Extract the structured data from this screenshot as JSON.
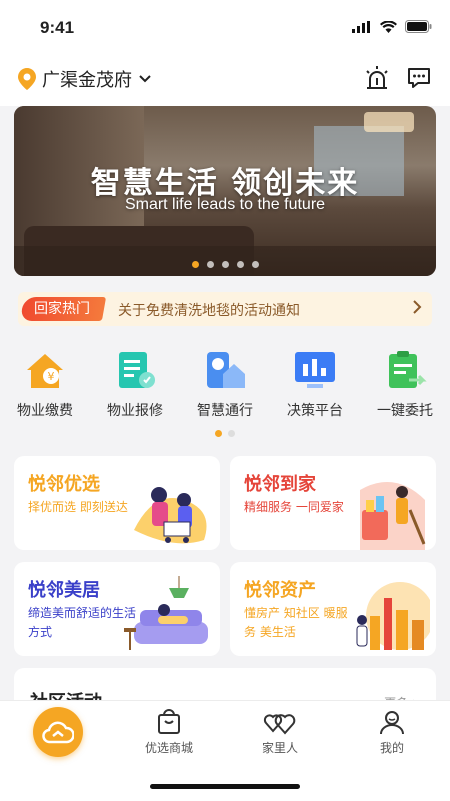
{
  "status": {
    "time": "9:41"
  },
  "header": {
    "location": "广渠金茂府"
  },
  "banner": {
    "title": "智慧生活 领创未来",
    "subtitle": "Smart life leads to the future",
    "dot_count": 5,
    "active_dot": 0
  },
  "notice": {
    "tag": "回家热门",
    "text": "关于免费清洗地毯的活动通知"
  },
  "services": [
    {
      "label": "物业缴费",
      "icon": "property-fee-icon",
      "color": "#f5a623"
    },
    {
      "label": "物业报修",
      "icon": "repair-icon",
      "color": "#26c6b0"
    },
    {
      "label": "智慧通行",
      "icon": "smart-access-icon",
      "color": "#4a8ef0"
    },
    {
      "label": "决策平台",
      "icon": "decision-platform-icon",
      "color": "#3b7cf5"
    },
    {
      "label": "一键委托",
      "icon": "one-click-delegate-icon",
      "color": "#3fc25a"
    }
  ],
  "cards": [
    {
      "title": "悦邻优选",
      "desc": "择优而选  即刻送达",
      "color": "#f5a623"
    },
    {
      "title": "悦邻到家",
      "desc": "精细服务 一同爱家",
      "color": "#e5453a"
    },
    {
      "title": "悦邻美居",
      "desc": "缔造美而舒适的生活方式",
      "color": "#3a40c9"
    },
    {
      "title": "悦邻资产",
      "desc": "懂房产 知社区 暖服务 美生活",
      "color": "#f5a623"
    }
  ],
  "activity": {
    "title": "社区活动",
    "more": "更多 >"
  },
  "tabbar": {
    "tabs": [
      {
        "label": "优选商城",
        "icon": "shopping-bag-icon"
      },
      {
        "label": "家里人",
        "icon": "hearts-icon"
      },
      {
        "label": "我的",
        "icon": "profile-icon"
      }
    ],
    "home_icon": "cloud-home-icon"
  },
  "colors": {
    "accent": "#f5a623",
    "notice_bg": "#fdf3e1",
    "notice_tag": "#f04a2f"
  }
}
